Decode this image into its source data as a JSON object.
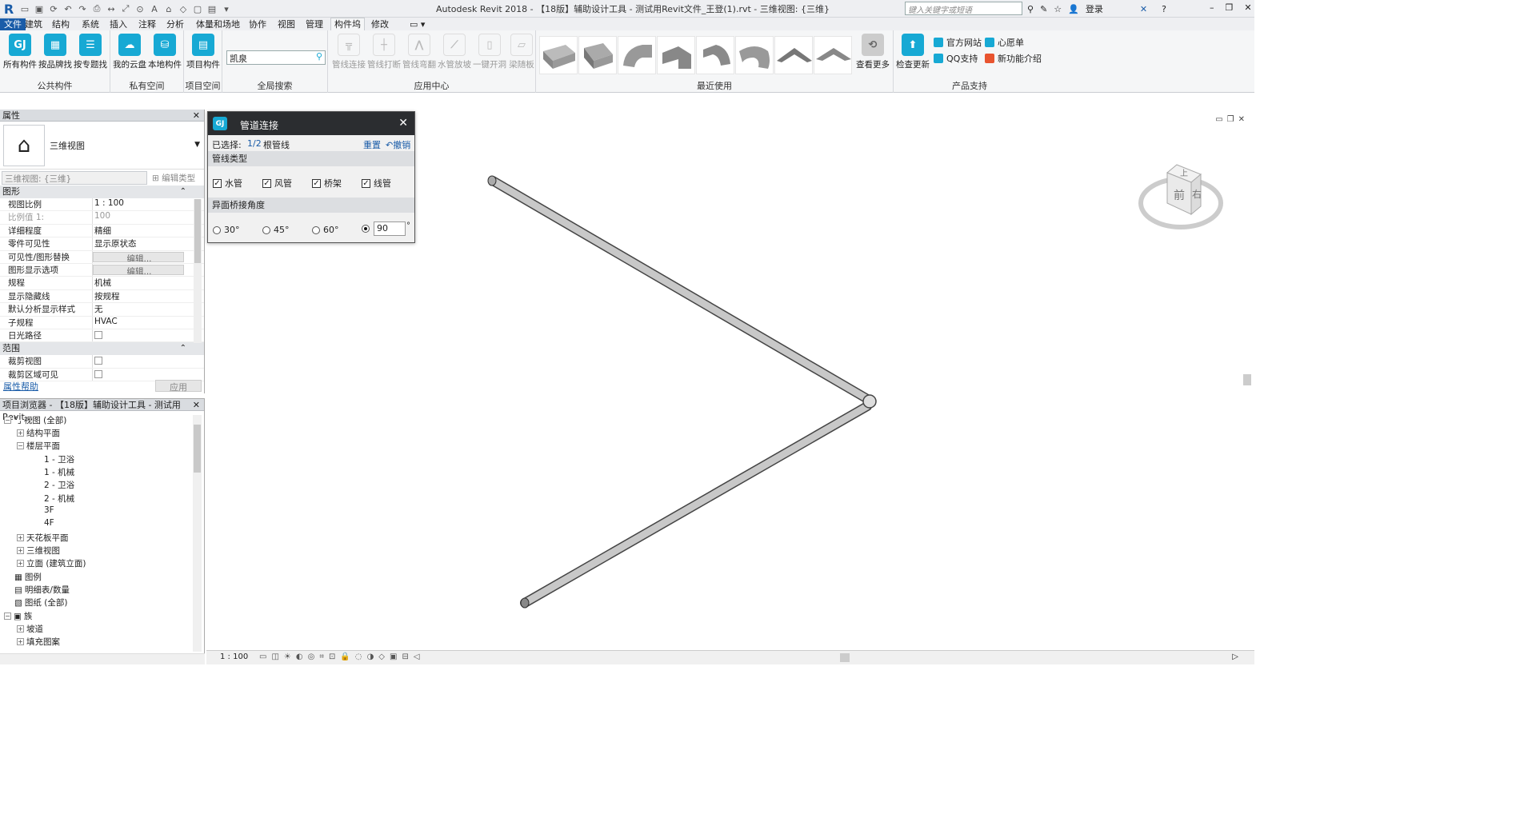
{
  "window": {
    "title": "Autodesk Revit 2018 -    【18版】辅助设计工具 - 测试用Revit文件_王登(1).rvt - 三维视图: {三维}",
    "search_placeholder": "键入关键字或短语",
    "login": "登录"
  },
  "tabs": [
    {
      "label": "文件"
    },
    {
      "label": "建筑"
    },
    {
      "label": "结构"
    },
    {
      "label": "系统"
    },
    {
      "label": "插入"
    },
    {
      "label": "注释"
    },
    {
      "label": "分析"
    },
    {
      "label": "体量和场地"
    },
    {
      "label": "协作"
    },
    {
      "label": "视图"
    },
    {
      "label": "管理"
    },
    {
      "label": "构件坞"
    },
    {
      "label": "修改"
    }
  ],
  "ribbon": {
    "public": {
      "label": "公共构件",
      "buttons": [
        "所有构件",
        "按品牌找",
        "按专题找"
      ]
    },
    "private": {
      "label": "私有空间",
      "buttons": [
        "我的云盘",
        "本地构件"
      ]
    },
    "project": {
      "label": "项目空间",
      "buttons": [
        "项目构件"
      ]
    },
    "search": {
      "label": "全局搜索",
      "value": "凯泉"
    },
    "apps": {
      "label": "应用中心",
      "buttons": [
        "管线连接",
        "管线打断",
        "管线弯翻",
        "水管放坡",
        "一键开洞",
        "梁随板"
      ]
    },
    "recent": {
      "label": "最近使用",
      "more": "查看更多"
    },
    "support": {
      "label": "产品支持",
      "update": "检查更新",
      "links": [
        "官方网站",
        "心愿单",
        "QQ支持",
        "新功能介绍"
      ]
    }
  },
  "properties": {
    "title": "属性",
    "type_name": "三维视图",
    "view_filter": "三维视图: {三维}",
    "edit_type": "编辑类型",
    "group_graphics": "图形",
    "rows": [
      {
        "k": "视图比例",
        "v": "1 : 100"
      },
      {
        "k": "比例值 1:",
        "v": "100"
      },
      {
        "k": "详细程度",
        "v": "精细"
      },
      {
        "k": "零件可见性",
        "v": "显示原状态"
      },
      {
        "k": "可见性/图形替换",
        "v": "编辑..."
      },
      {
        "k": "图形显示选项",
        "v": "编辑..."
      },
      {
        "k": "规程",
        "v": "机械"
      },
      {
        "k": "显示隐藏线",
        "v": "按规程"
      },
      {
        "k": "默认分析显示样式",
        "v": "无"
      },
      {
        "k": "子规程",
        "v": "HVAC"
      },
      {
        "k": "日光路径",
        "v": ""
      }
    ],
    "group_extents": "范围",
    "rows2": [
      {
        "k": "裁剪视图",
        "v": ""
      },
      {
        "k": "裁剪区域可见",
        "v": ""
      }
    ],
    "help": "属性帮助",
    "apply": "应用"
  },
  "browser": {
    "title": "项目浏览器 - 【18版】辅助设计工具 - 测试用Revit...",
    "nodes": [
      {
        "label": "视图 (全部)"
      },
      {
        "label": "结构平面"
      },
      {
        "label": "楼层平面"
      },
      {
        "label": "1 - 卫浴"
      },
      {
        "label": "1 - 机械"
      },
      {
        "label": "2 - 卫浴"
      },
      {
        "label": "2 - 机械"
      },
      {
        "label": "3F"
      },
      {
        "label": "4F"
      },
      {
        "label": "天花板平面"
      },
      {
        "label": "三维视图"
      },
      {
        "label": "立面 (建筑立面)"
      },
      {
        "label": "图例"
      },
      {
        "label": "明细表/数量"
      },
      {
        "label": "图纸 (全部)"
      },
      {
        "label": "族"
      },
      {
        "label": "坡道"
      },
      {
        "label": "填充图案"
      }
    ]
  },
  "dialog": {
    "title": "管道连接",
    "selected_label": "已选择:",
    "selected_count": "1/2",
    "selected_unit": "根管线",
    "reset": "重置",
    "undo": "撤销",
    "pipe_types_label": "管线类型",
    "pipe_types": [
      {
        "label": "水管",
        "checked": true
      },
      {
        "label": "风管",
        "checked": true
      },
      {
        "label": "桥架",
        "checked": true
      },
      {
        "label": "线管",
        "checked": true
      }
    ],
    "angle_label": "异面桥接角度",
    "angles": [
      {
        "label": "30°",
        "selected": false
      },
      {
        "label": "45°",
        "selected": false
      },
      {
        "label": "60°",
        "selected": false
      },
      {
        "label": "",
        "selected": true
      }
    ],
    "angle_value": "90",
    "angle_unit": "°"
  },
  "viewcube": {
    "top": "上",
    "front": "前",
    "right": "右"
  },
  "status": {
    "scale": "1 : 100"
  },
  "colors": {
    "accent": "#17a9d4",
    "revit_blue": "#1a5ca8",
    "dialog_header": "#2b2d30"
  }
}
